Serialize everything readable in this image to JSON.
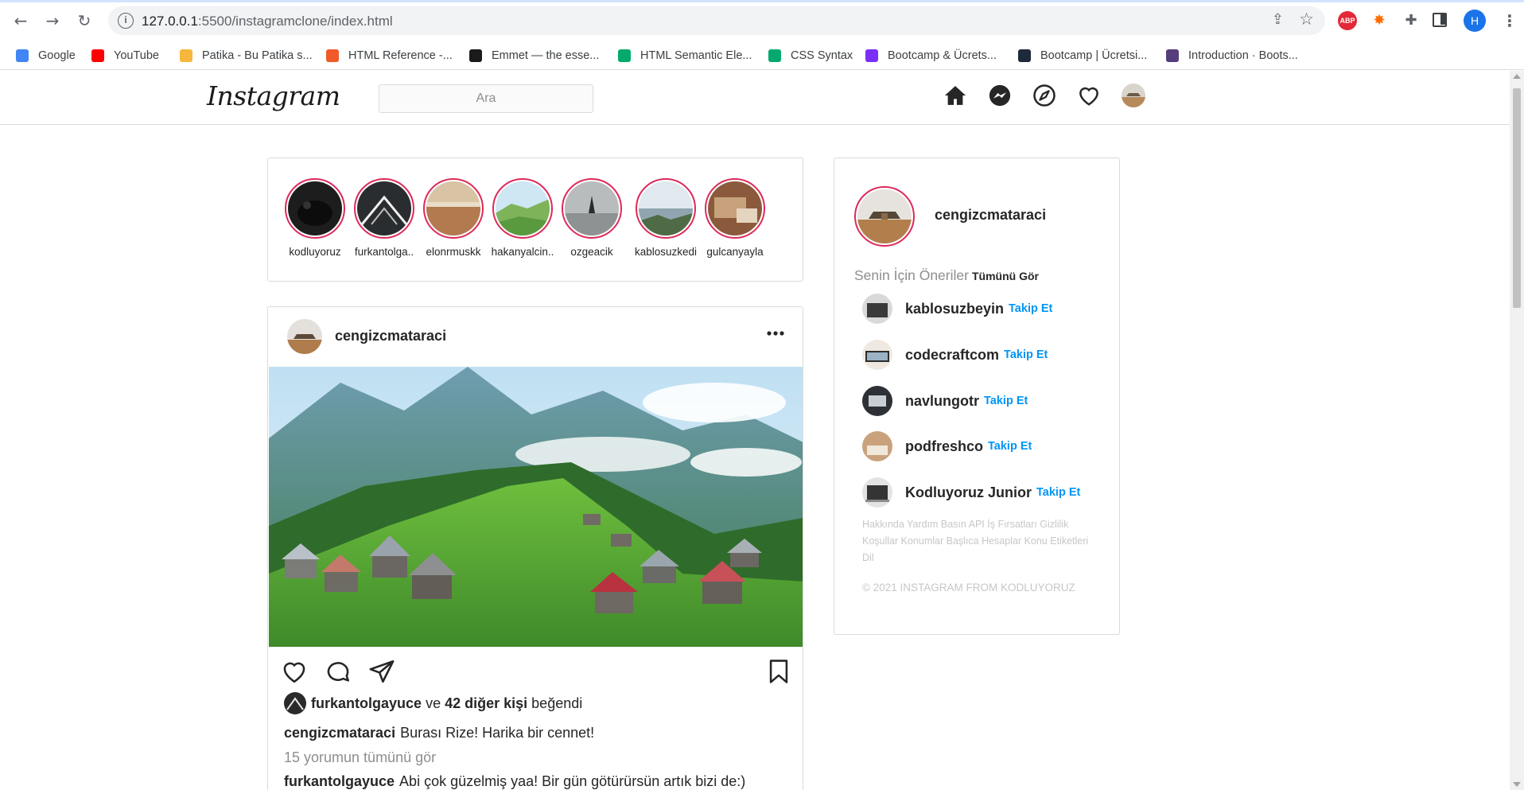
{
  "browser": {
    "url_host": "127.0.0.1",
    "url_path": ":5500/instagramclone/index.html",
    "profile_initial": "H",
    "extension_abp": "ABP",
    "bookmarks": [
      {
        "label": "Google",
        "icon": "google-icon",
        "color": "#4285f4"
      },
      {
        "label": "YouTube",
        "icon": "youtube-icon",
        "color": "#ff0000"
      },
      {
        "label": "Patika - Bu Patika s...",
        "icon": "patika-icon",
        "color": "#f6b73c"
      },
      {
        "label": "HTML Reference -...",
        "icon": "html-reference-icon",
        "color": "#f05a28"
      },
      {
        "label": "Emmet — the esse...",
        "icon": "emmet-icon",
        "color": "#1b1b1b"
      },
      {
        "label": "HTML Semantic Ele...",
        "icon": "w3schools-icon",
        "color": "#04aa6d"
      },
      {
        "label": "CSS Syntax",
        "icon": "w3schools-icon",
        "color": "#04aa6d"
      },
      {
        "label": "Bootcamp & Ücrets...",
        "icon": "bootcamp-icon",
        "color": "#7b2ff7"
      },
      {
        "label": "Bootcamp | Ücretsi...",
        "icon": "bootcamp-dark-icon",
        "color": "#1e2a3a"
      },
      {
        "label": "Introduction · Boots...",
        "icon": "bootstrap-icon",
        "color": "#563d7c"
      }
    ]
  },
  "header": {
    "logo": "Instagram",
    "search_placeholder": "Ara"
  },
  "stories": [
    {
      "name": "kodluyoruz"
    },
    {
      "name": "furkantolga.."
    },
    {
      "name": "elonrmuskk"
    },
    {
      "name": "hakanyalcin.."
    },
    {
      "name": "ozgeacik"
    },
    {
      "name": "kablosuzkedi"
    },
    {
      "name": "gulcanyayla"
    }
  ],
  "post": {
    "username": "cengizcmataraci",
    "liked_by": "furkantolgayuce",
    "liked_connector": "ve",
    "liked_others": "42 diğer kişi",
    "liked_suffix": "beğendi",
    "caption_user": "cengizcmataraci",
    "caption_text": "Burası Rize! Harika bir cennet!",
    "view_comments": "15 yorumun tümünü gör",
    "comment_user": "furkantolgayuce",
    "comment_text": "Abi çok güzelmiş yaa! Bir gün götürürsün artık bizi de:)"
  },
  "sidebar": {
    "username": "cengizcmataraci",
    "suggestions_title": "Senin İçin Öneriler",
    "see_all": "Tümünü Gör",
    "follow_label": "Takip Et",
    "suggestions": [
      {
        "name": "kablosuzbeyin"
      },
      {
        "name": "codecraftcom"
      },
      {
        "name": "navlungotr"
      },
      {
        "name": "podfreshco"
      },
      {
        "name": "Kodluyoruz Junior"
      }
    ],
    "footer_links": "Hakkında Yardım Basın API İş Fırsatları Gizlilik Koşullar Konumlar Başlıca Hesaplar Konu Etiketleri Dil",
    "copyright": "© 2021 INSTAGRAM FROM KODLUYORUZ"
  },
  "colors": {
    "story_ring": "#dd2a5a",
    "follow_blue": "#0095f6",
    "border": "#dbdbdb",
    "muted_text": "#8e8e8e"
  }
}
